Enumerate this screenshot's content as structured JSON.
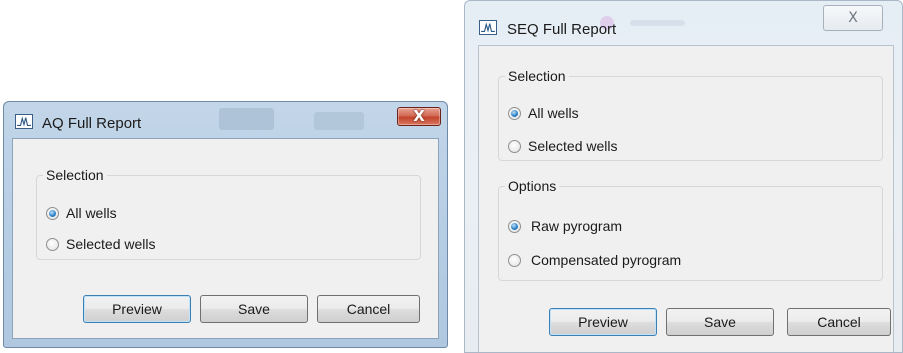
{
  "aq_dialog": {
    "title": "AQ Full Report",
    "close_label": "X",
    "selection_group": {
      "legend": "Selection",
      "options": [
        {
          "label": "All wells",
          "checked": true
        },
        {
          "label": "Selected wells",
          "checked": false
        }
      ]
    },
    "buttons": {
      "preview": "Preview",
      "save": "Save",
      "cancel": "Cancel"
    }
  },
  "seq_dialog": {
    "title": "SEQ Full Report",
    "close_label": "X",
    "selection_group": {
      "legend": "Selection",
      "options": [
        {
          "label": "All wells",
          "checked": true
        },
        {
          "label": "Selected wells",
          "checked": false
        }
      ]
    },
    "options_group": {
      "legend": "Options",
      "options": [
        {
          "label": "Raw pyrogram",
          "checked": true
        },
        {
          "label": "Compensated pyrogram",
          "checked": false
        }
      ]
    },
    "buttons": {
      "preview": "Preview",
      "save": "Save",
      "cancel": "Cancel"
    }
  },
  "icons": {
    "app": "waveform-report-icon",
    "close": "close-icon"
  },
  "colors": {
    "radio_checked": "#2f83c8",
    "close_red": "#c3432c",
    "dialog_face": "#f0f0f0"
  }
}
